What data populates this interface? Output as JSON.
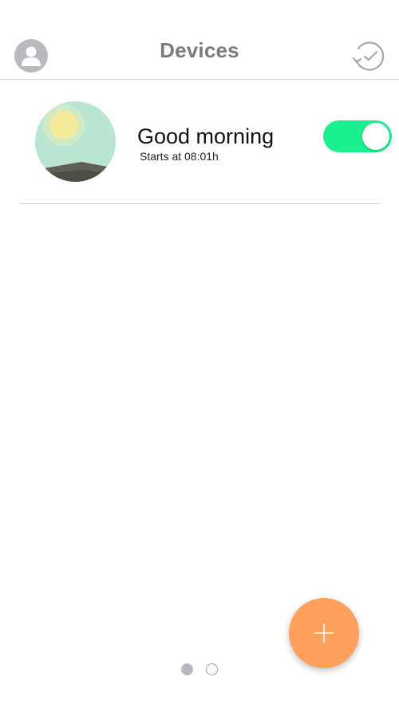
{
  "header": {
    "title": "Devices",
    "left_icon": "user-profile-icon",
    "right_icon": "clock-history-icon"
  },
  "routines": [
    {
      "name": "Good morning",
      "subtitle": "Starts at 08:01h",
      "enabled": true,
      "image_icon": "sunrise-illustration"
    }
  ],
  "pagination": {
    "pages": 2,
    "current": 1
  },
  "fab": {
    "icon": "plus-icon"
  },
  "colors": {
    "toggle_on": "#1bf08f",
    "fab": "#ffa05c",
    "header_title": "#7b7b7b",
    "illustration_sky": "#b8e6d0",
    "illustration_sun": "#f5e99a",
    "illustration_hill": "#5f5f55"
  }
}
